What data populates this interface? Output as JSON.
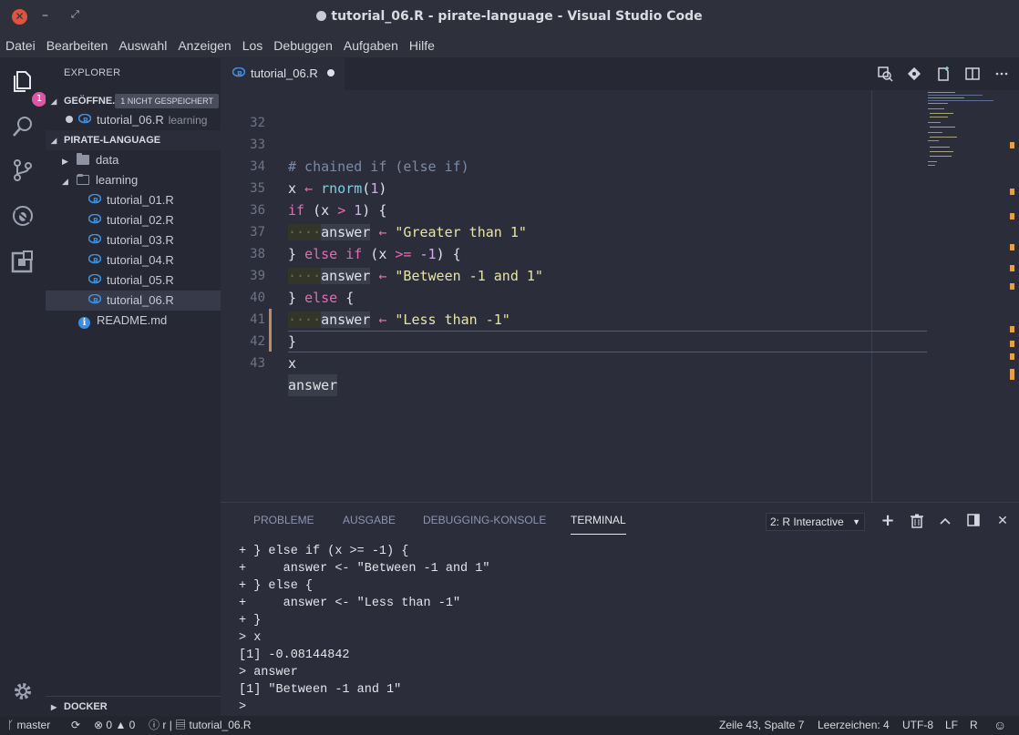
{
  "window": {
    "title": "tutorial_06.R - pirate-language - Visual Studio Code"
  },
  "menu": [
    "Datei",
    "Bearbeiten",
    "Auswahl",
    "Anzeigen",
    "Los",
    "Debuggen",
    "Aufgaben",
    "Hilfe"
  ],
  "activity": {
    "explorer_badge": "1"
  },
  "sidebar": {
    "title": "EXPLORER",
    "open_editors": {
      "label": "GEÖFFNE..",
      "badge": "1 NICHT GESPEICHERT",
      "file": "tutorial_06.R",
      "file_desc": "learning"
    },
    "project": {
      "label": "PIRATE-LANGUAGE",
      "items": [
        {
          "name": "data",
          "type": "folder"
        },
        {
          "name": "learning",
          "type": "folder"
        },
        {
          "name": "tutorial_01.R",
          "type": "r-file"
        },
        {
          "name": "tutorial_02.R",
          "type": "r-file"
        },
        {
          "name": "tutorial_03.R",
          "type": "r-file"
        },
        {
          "name": "tutorial_04.R",
          "type": "r-file"
        },
        {
          "name": "tutorial_05.R",
          "type": "r-file"
        },
        {
          "name": "tutorial_06.R",
          "type": "r-file",
          "selected": true
        },
        {
          "name": "README.md",
          "type": "info-file"
        }
      ]
    },
    "docker": {
      "label": "DOCKER"
    }
  },
  "editor": {
    "tab": {
      "label": "tutorial_06.R"
    },
    "lines": [
      {
        "num": "32"
      },
      {
        "num": "33"
      },
      {
        "num": "34"
      },
      {
        "num": "35"
      },
      {
        "num": "36"
      },
      {
        "num": "37"
      },
      {
        "num": "38"
      },
      {
        "num": "39"
      },
      {
        "num": "40"
      },
      {
        "num": "41"
      },
      {
        "num": "42"
      },
      {
        "num": "43"
      }
    ],
    "code": {
      "l33": "# chained if (else if)",
      "l34_var": "x",
      "l34_fn": "rnorm",
      "l34_num": "1",
      "l35_num": "1",
      "l36_str": "\"Greater than 1\"",
      "l37_num": "-1",
      "l38_str": "\"Between -1 and 1\"",
      "l40_str": "\"Less than -1\"",
      "l42": "x",
      "l43": "answer",
      "answer": "answer"
    }
  },
  "panel": {
    "tabs": [
      "PROBLEME",
      "AUSGABE",
      "DEBUGGING-KONSOLE",
      "TERMINAL"
    ],
    "terminal_select": "2: R Interactive",
    "terminal_lines": [
      "+ } else if (x >= -1) {",
      "+     answer <- \"Between -1 and 1\"",
      "+ } else {",
      "+     answer <- \"Less than -1\"",
      "+ }",
      "> x",
      "[1] -0.08144842",
      "> answer",
      "[1] \"Between -1 and 1\"",
      ">"
    ]
  },
  "status": {
    "branch": "master",
    "errors": "0",
    "warnings": "0",
    "lang_short": "r",
    "file": "tutorial_06.R",
    "position": "Zeile 43, Spalte 7",
    "indent": "Leerzeichen: 4",
    "encoding": "UTF-8",
    "eol": "LF",
    "language": "R"
  },
  "colors": {
    "accent_pink": "#e86ab4",
    "modified_bar": "#c08a5a",
    "overview_marker": "#e3a04a"
  }
}
